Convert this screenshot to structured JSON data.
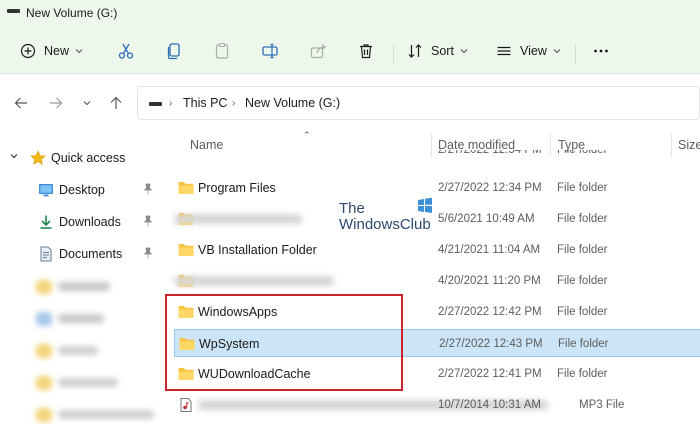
{
  "window": {
    "title": "New Volume (G:)"
  },
  "toolbar": {
    "new_label": "New",
    "sort_label": "Sort",
    "view_label": "View",
    "more_label": "..."
  },
  "address": {
    "crumbs": [
      "This PC",
      "New Volume (G:)"
    ]
  },
  "sidebar": {
    "items": [
      {
        "label": "Quick access",
        "icon": "star-icon"
      },
      {
        "label": "Desktop",
        "icon": "desktop-icon"
      },
      {
        "label": "Downloads",
        "icon": "download-icon"
      },
      {
        "label": "Documents",
        "icon": "document-icon"
      }
    ]
  },
  "columns": {
    "name": "Name",
    "date": "Date modified",
    "type": "Type",
    "size": "Size"
  },
  "files": [
    {
      "name": "",
      "date": "2/27/2022 12:54 PM",
      "type": "File folder",
      "partial": true
    },
    {
      "name": "Program Files",
      "date": "2/27/2022 12:34 PM",
      "type": "File folder"
    },
    {
      "name": "",
      "date": "5/6/2021 10:49 AM",
      "type": "File folder",
      "blurred": true
    },
    {
      "name": "VB Installation Folder",
      "date": "4/21/2021 11:04 AM",
      "type": "File folder"
    },
    {
      "name": "",
      "date": "4/20/2021 11:20 PM",
      "type": "File folder",
      "blurred": true
    },
    {
      "name": "WindowsApps",
      "date": "2/27/2022 12:42 PM",
      "type": "File folder"
    },
    {
      "name": "WpSystem",
      "date": "2/27/2022 12:43 PM",
      "type": "File folder",
      "selected": true
    },
    {
      "name": "WUDownloadCache",
      "date": "2/27/2022 12:41 PM",
      "type": "File folder"
    },
    {
      "name": "",
      "date": "10/7/2014 10:31 AM",
      "type": "MP3 File",
      "blurred": true
    }
  ],
  "watermark": {
    "line1": "The",
    "line2": "WindowsClub"
  },
  "colors": {
    "toolbar_bg": "#eef7ec",
    "selection_bg": "#cce4f7",
    "highlight_border": "#c9252b",
    "folder_yellow": "#f6c342"
  }
}
